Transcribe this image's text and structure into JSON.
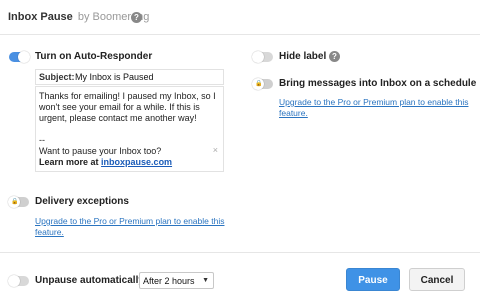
{
  "header": {
    "app_name": "Inbox Pause",
    "by_text": "by Boomerang",
    "help_icon": "?"
  },
  "autoresponder": {
    "label": "Turn on Auto-Responder",
    "enabled": true,
    "subject_label": "Subject:",
    "subject_value": "My Inbox is Paused",
    "message_line1": "Thanks for emailing! I paused my Inbox, so I",
    "message_line2": "won't see your email for a while. If this is",
    "message_line3": "urgent, please contact me another way!",
    "signature_dash": "--",
    "signature_line1": "Want to pause your Inbox too?",
    "signature_learn": "Learn more at",
    "signature_link": "inboxpause.com",
    "clear_icon": "×"
  },
  "delivery": {
    "label": "Delivery exceptions",
    "upgrade_line1": "Upgrade to the Pro or Premium plan to enable this",
    "upgrade_line2": "feature."
  },
  "hide_label": {
    "label": "Hide label",
    "enabled": false,
    "help_icon": "?"
  },
  "schedule": {
    "label": "Bring messages into Inbox on a schedule",
    "upgrade_line1": "Upgrade to the Pro or Premium plan to enable this",
    "upgrade_line2": "feature."
  },
  "unpause": {
    "label": "Unpause automatically",
    "enabled": false,
    "selected": "After 2 hours",
    "caret": "▼"
  },
  "buttons": {
    "primary": "Pause",
    "secondary": "Cancel"
  },
  "icons": {
    "lock": "🔒"
  },
  "colors": {
    "accent": "#4a90e2",
    "link": "#2a74c0",
    "primary_button": "#3f92e6"
  }
}
